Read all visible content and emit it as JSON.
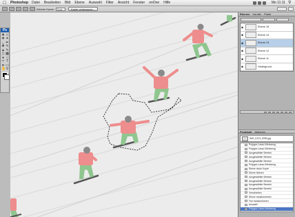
{
  "menubar": {
    "apple_glyph": "",
    "app_name": "Photoshop",
    "items": [
      "Datei",
      "Bearbeiten",
      "Bild",
      "Ebene",
      "Auswahl",
      "Filter",
      "Ansicht",
      "Fenster",
      "onOne",
      "Hilfe"
    ],
    "clock": "Mo 11:11"
  },
  "options": {
    "feather_label": "Weiche Kante:",
    "feather_value": "0 px",
    "refine_button": "Kante verbessern..."
  },
  "toolbox": {
    "logo": "Ps"
  },
  "layers_panel": {
    "tabs": [
      "Ebenen",
      "Kanäle",
      "Pfade"
    ],
    "layers": [
      {
        "name": "Ebene 15",
        "selected": false
      },
      {
        "name": "Ebene 14",
        "selected": false
      },
      {
        "name": "Ebene 13",
        "selected": true
      },
      {
        "name": "Ebene 12",
        "selected": false
      },
      {
        "name": "Ebene 11",
        "selected": false
      },
      {
        "name": "Hintergrund",
        "selected": false
      }
    ]
  },
  "history_panel": {
    "tabs": [
      "Protokoll",
      "Aktionen"
    ],
    "snapshot_name": "IMG_0123_0035.jpg",
    "steps": [
      {
        "label": "Polygon-Lasso-Werkzeug",
        "selected": false
      },
      {
        "label": "Polygon-Lasso-Werkzeug",
        "selected": false
      },
      {
        "label": "Ausgewählter Bereich",
        "selected": false
      },
      {
        "label": "Ausgewählter Bereich",
        "selected": false
      },
      {
        "label": "Ausgewählter Bereich",
        "selected": false
      },
      {
        "label": "Polygon-Lasso-Werkzeug",
        "selected": false
      },
      {
        "label": "Ebene durch Kopie",
        "selected": false
      },
      {
        "label": "Ebene fixieren",
        "selected": false
      },
      {
        "label": "Ausgewählter Bereich",
        "selected": false
      },
      {
        "label": "Ausgewählter Bereich",
        "selected": false
      },
      {
        "label": "Ausgewählter Bereich",
        "selected": false
      },
      {
        "label": "Ausgewählter Bereich",
        "selected": false
      },
      {
        "label": "Verschieben",
        "selected": false
      },
      {
        "label": "Ebene transformieren",
        "selected": false
      },
      {
        "label": "Frei transformieren",
        "selected": false
      },
      {
        "label": "Auswahl",
        "selected": false
      },
      {
        "label": "Polygon-Lasso-Werkzeug",
        "selected": true
      }
    ]
  },
  "colors": {
    "jacket": "#ee8d8d",
    "pants": "#8fc68f",
    "snow": "#ececec",
    "selection": "#4b76c2"
  }
}
